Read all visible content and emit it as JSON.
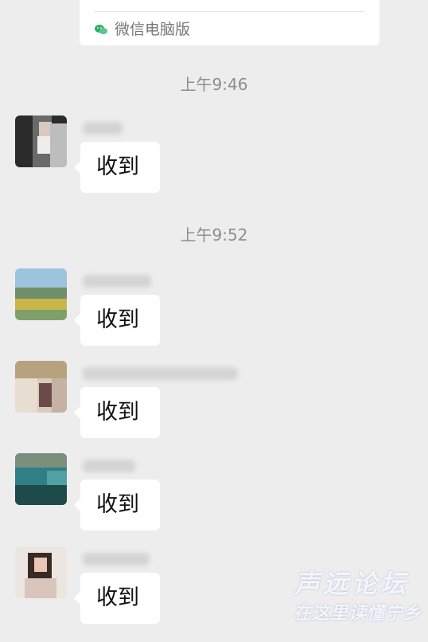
{
  "top_card": {
    "source_label": "微信电脑版",
    "source_icon": "wechat-icon"
  },
  "times": [
    "上午9:46",
    "上午9:52"
  ],
  "messages": [
    {
      "text": "收到",
      "avatar": "blurred-portrait"
    },
    {
      "text": "收到",
      "avatar": "landscape-photo"
    },
    {
      "text": "收到",
      "avatar": "blurred-photo"
    },
    {
      "text": "收到",
      "avatar": "lake-landscape"
    },
    {
      "text": "收到",
      "avatar": "blurred-portrait"
    }
  ],
  "watermark": {
    "line1": "声远论坛",
    "line2": "在这里读懂宁乡"
  },
  "colors": {
    "background": "#ededed",
    "bubble": "#ffffff",
    "time_text": "#8e8e8e",
    "wechat_green": "#2aae67"
  }
}
